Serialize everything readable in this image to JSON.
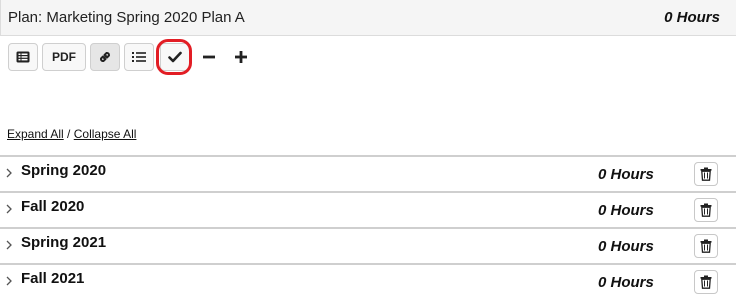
{
  "header": {
    "plan_title": "Plan: Marketing Spring 2020 Plan A",
    "total_hours": "0 Hours"
  },
  "toolbar": {
    "pdf_label": "PDF",
    "buttons": [
      {
        "icon": "list-alt-icon"
      },
      {
        "icon": "pdf"
      },
      {
        "icon": "link-icon",
        "state": "active"
      },
      {
        "icon": "bullet-list-icon"
      },
      {
        "icon": "check-icon",
        "state": "highlighted"
      },
      {
        "icon": "minus-icon"
      },
      {
        "icon": "plus-icon"
      }
    ]
  },
  "links": {
    "expand_all": "Expand All",
    "separator": " / ",
    "collapse_all": "Collapse All"
  },
  "sections": [
    {
      "name": "Spring 2020",
      "hours": "0 Hours"
    },
    {
      "name": "Fall 2020",
      "hours": "0 Hours"
    },
    {
      "name": "Spring 2021",
      "hours": "0 Hours"
    },
    {
      "name": "Fall 2021",
      "hours": "0 Hours"
    }
  ],
  "colors": {
    "highlight": "#e21d24",
    "header_bg": "#f5f5f5",
    "button_bg": "#f8f8f8",
    "active_button_bg": "#e6e6e6"
  }
}
